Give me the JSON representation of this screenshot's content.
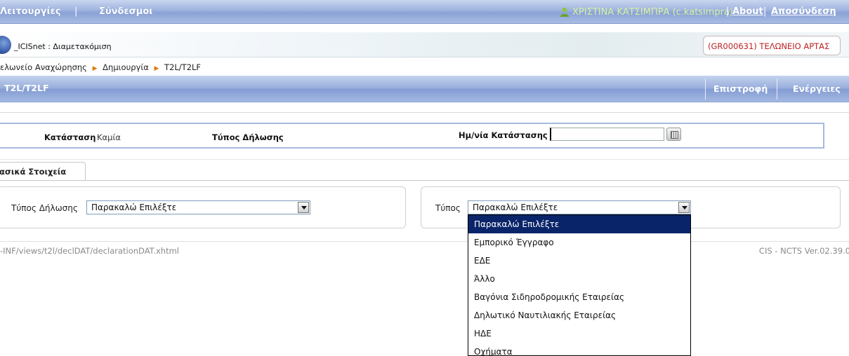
{
  "topnav": {
    "menu_functions": "Λειτουργίες",
    "menu_links": "Σύνδεσμοι",
    "user": "ΧΡΙΣΤΙΝΑ ΚΑΤΣΙΜΠΡΑ (c.katsimpra)",
    "about": "About",
    "logout": "Αποσύνδεση",
    "separator": "|"
  },
  "app": {
    "title": "_ICISnet : Διαμετακόμιση",
    "office": "(GR000631) ΤΕΛΩΝΕΙΟ ΑΡΤΑΣ"
  },
  "breadcrumb": {
    "items": [
      "ελωνείο Αναχώρησης",
      "Δημιουργία",
      "T2L/T2LF"
    ]
  },
  "titlebar": {
    "title": "T2L/T2LF",
    "back": "Επιστροφή",
    "actions": "Ενέργειες"
  },
  "status": {
    "state_label": "Κατάσταση",
    "state_value": "Καμία",
    "decl_type_label": "Τύπος Δήλωσης",
    "state_date_label": "Ημ/νία Κατάστασης",
    "state_date_value": ""
  },
  "tab": {
    "label": "ασικά Στοιχεία"
  },
  "form": {
    "decl_type_label": "Τύπος Δήλωσης",
    "decl_type_value": "Παρακαλώ Επιλέξτε",
    "type_label": "Τύπος",
    "type_value": "Παρακαλώ Επιλέξτε"
  },
  "dropdown": {
    "options": [
      "Παρακαλώ Επιλέξτε",
      "Εμπορικό Έγγραφο",
      "ΕΔΕ",
      "Άλλο",
      "Βαγόνια Σιδηροδρομικής Εταιρείας",
      "Δηλωτικό Ναυτιλιακής Εταιρείας",
      "ΗΔΕ",
      "Οχήματα"
    ],
    "selected_index": 0
  },
  "footer": {
    "path": "-INF/views/t2l/declDAT/declarationDAT.xhtml",
    "version": "CIS - NCTS Ver.02.39.0"
  },
  "colors": {
    "nav_blue": "#8aa2d6",
    "selection": "#0a246a",
    "office_text": "#bb2222",
    "user_text": "#d7f0a0"
  }
}
